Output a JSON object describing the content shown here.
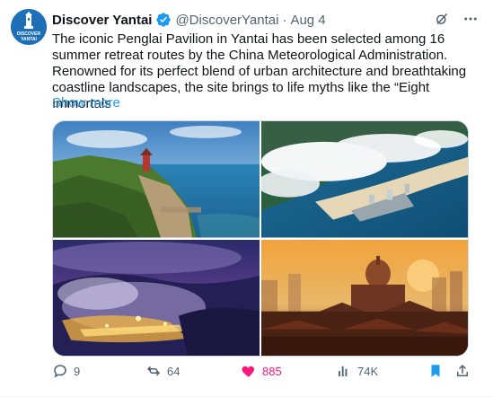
{
  "author": {
    "name": "Discover Yantai",
    "handle": "@DiscoverYantai",
    "separator": "·",
    "date": "Aug 4",
    "avatar_text_1": "DISCOVER",
    "avatar_text_2": "YANTAI"
  },
  "tweet": {
    "text": "The iconic Penglai Pavilion in Yantai has been selected among 16 summer retreat routes by the China Meteorological Administration. Renowned for its perfect blend of urban architecture and breathtaking coastline landscapes, the site brings to life myths like the “Eight Immortals",
    "show_more": "Show more"
  },
  "media": {
    "images": [
      {
        "name": "penglai-pavilion-coast-photo"
      },
      {
        "name": "cloud-sea-coastal-city-photo"
      },
      {
        "name": "night-fog-pavilion-photo"
      },
      {
        "name": "sunset-pavilion-skyline-photo"
      }
    ]
  },
  "actions": {
    "replies": "9",
    "reposts": "64",
    "likes": "885",
    "views": "74K"
  },
  "icons": {
    "verified": "verified-badge-icon",
    "grok": "grok-icon",
    "more": "more-icon",
    "reply": "reply-icon",
    "repost": "repost-icon",
    "like": "heart-icon",
    "views": "views-icon",
    "bookmark": "bookmark-icon",
    "share": "share-icon"
  },
  "colors": {
    "accent": "#1d9bf0",
    "like": "#f91880",
    "muted": "#536471",
    "text": "#0f1419"
  }
}
